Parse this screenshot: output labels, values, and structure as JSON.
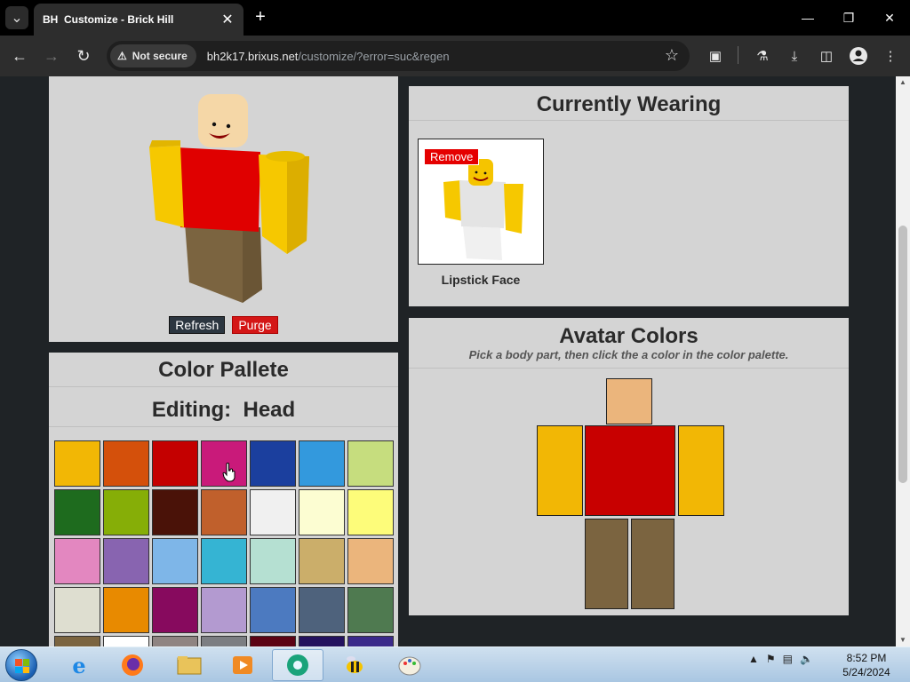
{
  "browser": {
    "tab_favicon": "BH",
    "tab_title": "Customize - Brick Hill",
    "security_label": "Not secure",
    "url_host": "bh2k17.brixus.net",
    "url_path": "/customize/?error=suc&regen"
  },
  "avatar_preview": {
    "refresh_label": "Refresh",
    "purge_label": "Purge",
    "colors": {
      "head": "#f5d7a7",
      "torso": "#e00000",
      "arms": "#f6c800",
      "legs": "#7b6440"
    }
  },
  "currently_wearing": {
    "title": "Currently Wearing",
    "items": [
      {
        "name": "Lipstick Face",
        "remove_label": "Remove"
      }
    ]
  },
  "palette": {
    "title": "Color Pallete",
    "editing_label": "Editing:",
    "editing_part": "Head",
    "colors": [
      "#f2b705",
      "#d4500b",
      "#c40000",
      "#c91a7a",
      "#1b3f9e",
      "#3399dd",
      "#c6dd7e",
      "#1e6b1e",
      "#86ae07",
      "#4a1208",
      "#c0602c",
      "#f0f0f0",
      "#fcfdd2",
      "#fdfc7a",
      "#e387c0",
      "#8864b0",
      "#7eb6e8",
      "#35b4d3",
      "#b5e0d2",
      "#cbae6a",
      "#ebb57c",
      "#deded0",
      "#e88a00",
      "#870a5e",
      "#b39ad0",
      "#4c7ac0",
      "#4e627c",
      "#4f7a50",
      "#7b6440",
      "#ffffff",
      "#8f8482",
      "#7c7e82",
      "#5c0314",
      "#24125e",
      "#3b2a8a"
    ]
  },
  "avatar_colors": {
    "title": "Avatar Colors",
    "hint": "Pick a body part, then click the a color in the color palette.",
    "parts": {
      "head": "#ebb57c",
      "torso": "#c80000",
      "left_arm": "#f2b705",
      "right_arm": "#f2b705",
      "left_leg": "#7b6440",
      "right_leg": "#7b6440"
    }
  },
  "taskbar": {
    "time": "8:52 PM",
    "date": "5/24/2024"
  }
}
